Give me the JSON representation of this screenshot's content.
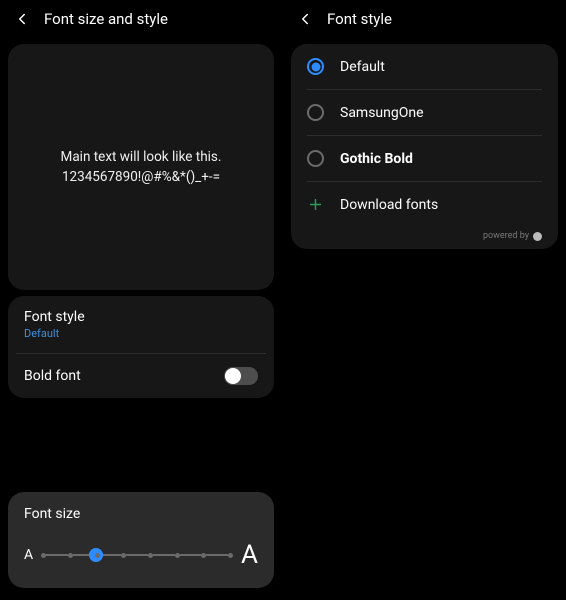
{
  "left": {
    "title": "Font size and style",
    "preview_line1": "Main text will look like this.",
    "preview_line2": "1234567890!@#%&*()_+-=",
    "font_style_label": "Font style",
    "font_style_value": "Default",
    "bold_label": "Bold font",
    "bold_on": false,
    "size_label": "Font size",
    "size_steps": 8,
    "size_value_index": 2
  },
  "right": {
    "title": "Font style",
    "options": [
      {
        "label": "Default",
        "selected": true,
        "bold": false
      },
      {
        "label": "SamsungOne",
        "selected": false,
        "bold": false
      },
      {
        "label": "Gothic Bold",
        "selected": false,
        "bold": true
      }
    ],
    "download_label": "Download fonts",
    "powered_label": "powered by"
  },
  "colors": {
    "accent": "#2d8cff",
    "link": "#3d8fd9",
    "green": "#2a9d5a"
  }
}
